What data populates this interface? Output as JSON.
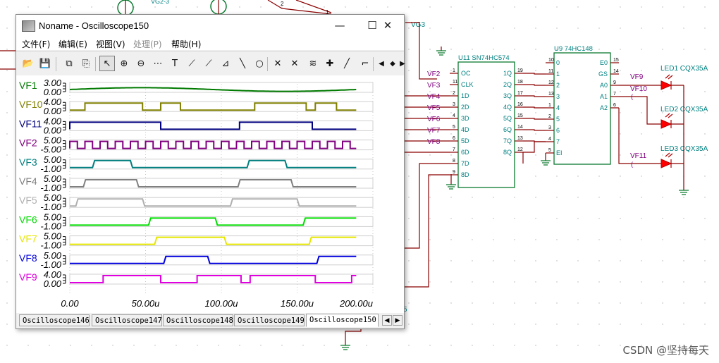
{
  "window": {
    "title": "Noname - Oscilloscope150",
    "minimize": "—",
    "maximize": "☐",
    "close": "✕"
  },
  "menu": [
    "文件(F)",
    "编辑(E)",
    "视图(V)",
    "处理(P)",
    "帮助(H)"
  ],
  "menu_disabled": [
    false,
    false,
    false,
    true,
    false
  ],
  "toolbar": {
    "icons": [
      "open-icon",
      "save-icon",
      "copy-icon",
      "paste-icon",
      "pointer-icon",
      "zoom-in-icon",
      "zoom-out-icon",
      "grid-icon",
      "text-icon",
      "cursor-tool-icon",
      "cursor-tool-2-icon",
      "measure-icon",
      "line-icon",
      "circle-icon",
      "marker-a-icon",
      "marker-b-icon",
      "add-cursor-icon",
      "add-marker-icon",
      "probe-icon",
      "edge-icon",
      "scroll-left-icon",
      "scroll-vertical-icon",
      "scroll-right-icon"
    ],
    "zoom_out_label": "100"
  },
  "chart_data": {
    "type": "line",
    "xlabel": "",
    "x_range": [
      0,
      200
    ],
    "x_ticks": [
      {
        "value": 0,
        "label": "0.00"
      },
      {
        "value": 50,
        "label": "50.00u"
      },
      {
        "value": 100,
        "label": "100.00u"
      },
      {
        "value": 150,
        "label": "150.00u"
      },
      {
        "value": 200,
        "label": "200.00u"
      }
    ],
    "data_end": 189,
    "series": [
      {
        "name": "VF1",
        "color": "#007a00",
        "top": "3.00",
        "bottom": "0.00",
        "kind": "sine",
        "high": [],
        "period": 189
      },
      {
        "name": "VF10",
        "color": "#808000",
        "top": "4.00",
        "bottom": "0.00",
        "kind": "digital",
        "high": [
          [
            10,
            48
          ],
          [
            60,
            73
          ],
          [
            122,
            156
          ],
          [
            162,
            176
          ]
        ]
      },
      {
        "name": "VF11",
        "color": "#000080",
        "top": "4.00",
        "bottom": "0.00",
        "kind": "digital",
        "high": [
          [
            0,
            60
          ],
          [
            112,
            160
          ]
        ]
      },
      {
        "name": "VF2",
        "color": "#800080",
        "top": "5.00",
        "bottom": "-5.00",
        "kind": "clock",
        "high": [],
        "period": 10
      },
      {
        "name": "VF3",
        "color": "#007f7f",
        "top": "5.00",
        "bottom": "-1.00",
        "kind": "analog",
        "high": [
          [
            15,
            40
          ],
          [
            117,
            142
          ]
        ]
      },
      {
        "name": "VF4",
        "color": "#808080",
        "top": "5.00",
        "bottom": "-1.00",
        "kind": "analog",
        "high": [
          [
            9,
            44
          ],
          [
            111,
            146
          ]
        ]
      },
      {
        "name": "VF5",
        "color": "#b0b0b0",
        "top": "5.00",
        "bottom": "-1.00",
        "kind": "analog",
        "high": [
          [
            4,
            48
          ],
          [
            106,
            150
          ]
        ]
      },
      {
        "name": "VF6",
        "color": "#00dd00",
        "top": "5.00",
        "bottom": "-1.00",
        "kind": "analog_low",
        "high": [
          [
            52,
            96
          ],
          [
            154,
            189
          ]
        ]
      },
      {
        "name": "VF7",
        "color": "#e6e600",
        "top": "5.00",
        "bottom": "-1.00",
        "kind": "analog_low",
        "high": [
          [
            56,
            102
          ],
          [
            158,
            189
          ]
        ]
      },
      {
        "name": "VF8",
        "color": "#0000dd",
        "top": "5.00",
        "bottom": "-1.00",
        "kind": "analog_low",
        "high": [
          [
            62,
            91
          ],
          [
            163,
            189
          ]
        ]
      },
      {
        "name": "VF9",
        "color": "#e000e0",
        "top": "4.00",
        "bottom": "0.00",
        "kind": "digital",
        "high": [
          [
            22,
            60
          ],
          [
            84,
            113
          ],
          [
            119,
            162
          ],
          [
            186,
            189
          ]
        ]
      }
    ]
  },
  "tabs": [
    "Oscilloscope146",
    "Oscilloscope147",
    "Oscilloscope148",
    "Oscilloscope149",
    "Oscilloscope150"
  ],
  "active_tab": 4,
  "schematic": {
    "u11": {
      "title": "U11 SN74HC574",
      "left_pins": [
        "OC",
        "CLK",
        "1D",
        "2D",
        "3D",
        "4D",
        "5D",
        "6D",
        "7D",
        "8D"
      ],
      "left_nums": [
        "1",
        "11",
        "2",
        "3",
        "4",
        "5",
        "6",
        "7",
        "8",
        "9"
      ],
      "right_pins": [
        "1Q",
        "2Q",
        "3Q",
        "4Q",
        "5Q",
        "6Q",
        "7Q",
        "8Q"
      ],
      "right_nums": [
        "19",
        "18",
        "17",
        "16",
        "15",
        "14",
        "13",
        "12"
      ]
    },
    "u9": {
      "title": "U9 74HC148",
      "left_pins": [
        "0",
        "1",
        "2",
        "3",
        "4",
        "5",
        "6",
        "7",
        "EI"
      ],
      "left_nums": [
        "10",
        "11",
        "12",
        "13",
        "1",
        "2",
        "3",
        "4",
        "5"
      ],
      "right_pins": [
        "E0",
        "GS",
        "A0",
        "A1",
        "A2"
      ],
      "right_nums": [
        "15",
        "14",
        "9",
        "7",
        "6"
      ]
    },
    "leds": [
      "LED1 CQX35A",
      "LED2 CQX35A",
      "LED3 CQX35A"
    ],
    "probes": [
      "VF2",
      "VF3",
      "VF4",
      "VF5",
      "VF6",
      "VF7",
      "VF8",
      "VF9",
      "VF10",
      "VF11"
    ],
    "labels": {
      "vg3": "VG3",
      "vg2": "VG2-3",
      "num5": "5",
      "num1": "1",
      "num2": "2"
    }
  },
  "watermark": "CSDN @坚持每天"
}
